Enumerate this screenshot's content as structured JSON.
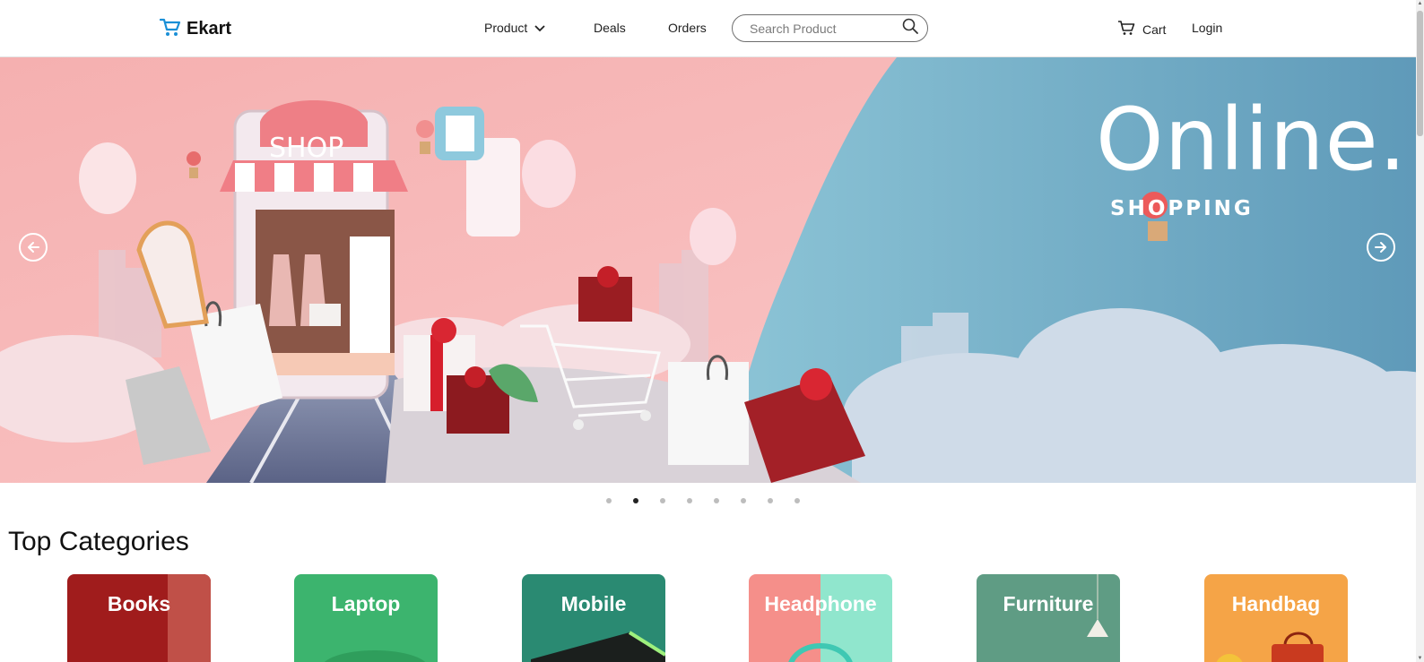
{
  "header": {
    "brand": "Ekart",
    "nav": {
      "product": "Product",
      "deals": "Deals",
      "orders": "Orders",
      "cart": "Cart",
      "login": "Login"
    },
    "search": {
      "placeholder": "Search Product",
      "value": ""
    }
  },
  "hero": {
    "headline": "Online.",
    "subline": "SHOPPING",
    "shop_sign": "SHOP",
    "slide_count": 8,
    "active_slide": 2,
    "colors": {
      "left_bg": "#f7b8b8",
      "right_bg": "#7fb3cc"
    }
  },
  "main": {
    "section_title": "Top Categories",
    "categories": [
      {
        "label": "Books",
        "color": "#a01c1c"
      },
      {
        "label": "Laptop",
        "color": "#3cb46e"
      },
      {
        "label": "Mobile",
        "color": "#2a8a72"
      },
      {
        "label": "Headphone",
        "color": "#f58f8a"
      },
      {
        "label": "Furniture",
        "color": "#5f9c84"
      },
      {
        "label": "Handbag",
        "color": "#f5a447"
      }
    ]
  },
  "icons": {
    "brand": "shopping-cart-icon",
    "product_menu": "chevron-down-icon",
    "search": "search-icon",
    "cart": "cart-icon",
    "prev": "arrow-left-circle-icon",
    "next": "arrow-right-circle-icon"
  }
}
